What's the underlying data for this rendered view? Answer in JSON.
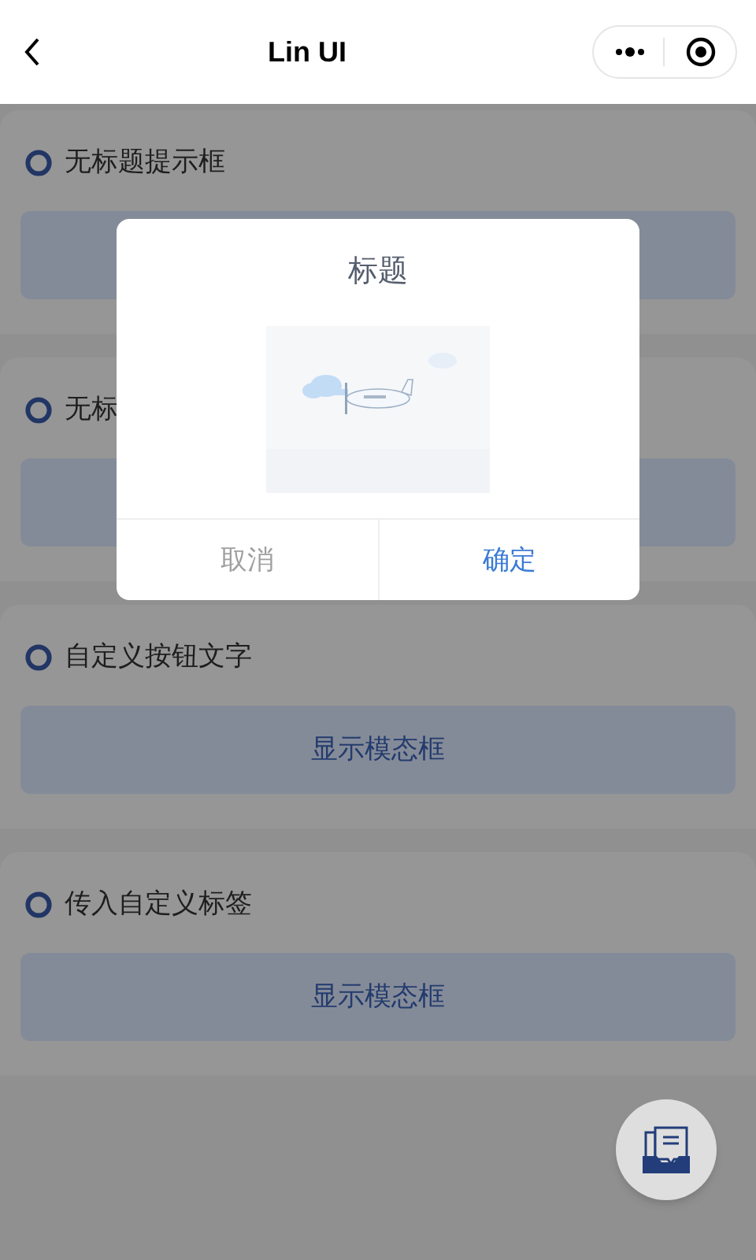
{
  "nav": {
    "title": "Lin UI"
  },
  "sections": [
    {
      "title": "无标题提示框"
    },
    {
      "title": "无标"
    },
    {
      "title": "自定义按钮文字",
      "button": "显示模态框"
    },
    {
      "title": "传入自定义标签",
      "button": "显示模态框"
    }
  ],
  "modal": {
    "title": "标题",
    "buttons": [
      {
        "label": "取消",
        "kind": "cancel"
      },
      {
        "label": "确定",
        "kind": "confirm"
      }
    ]
  }
}
